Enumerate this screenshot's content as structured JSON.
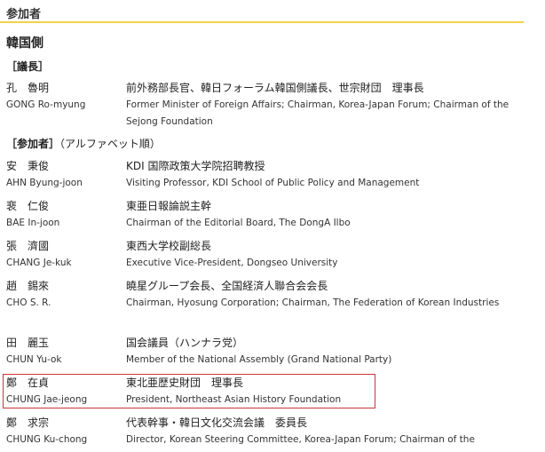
{
  "header": {
    "title": "参加者"
  },
  "side_title": "韓国側",
  "chair_section": {
    "label": "［議長］"
  },
  "participants_section": {
    "label": "［参加者］",
    "note": "（アルファベット順）"
  },
  "chair": [
    {
      "name_jp": "孔　魯明",
      "name_en": "GONG Ro-myung",
      "title_jp": "前外務部長官、韓日フォーラム韓国側議長、世宗財団　理事長",
      "title_en": "Former Minister of Foreign Affairs; Chairman, Korea-Japan Forum; Chairman of the Sejong Foundation"
    }
  ],
  "participants": [
    {
      "name_jp": "安　秉俊",
      "name_en": "AHN Byung-joon",
      "title_jp": "KDI 国際政策大学院招聘教授",
      "title_en": "Visiting Professor, KDI School of Public Policy and Management"
    },
    {
      "name_jp": "裵　仁俊",
      "name_en": "BAE In-joon",
      "title_jp": "東亜日報論説主幹",
      "title_en": "Chairman of the Editorial Board, The DongA Ilbo"
    },
    {
      "name_jp": "張　濟國",
      "name_en": "CHANG Je-kuk",
      "title_jp": "東西大学校副総長",
      "title_en": "Executive Vice-President, Dongseo University"
    },
    {
      "name_jp": "趙　錫來",
      "name_en": "CHO S. R.",
      "title_jp": "曉星グループ会長、全国経済人聯合会会長",
      "title_en": "Chairman, Hyosung Corporation; Chairman, The Federation of Korean Industries"
    },
    {
      "name_jp": "田　麗玉",
      "name_en": "CHUN Yu-ok",
      "title_jp": "国会議員（ハンナラ党）",
      "title_en": "Member of the National Assembly (Grand National Party)"
    },
    {
      "name_jp": "鄭　在貞",
      "name_en": "CHUNG Jae-jeong",
      "title_jp": "東北亜歴史財団　理事長",
      "title_en": "President, Northeast Asian History Foundation"
    },
    {
      "name_jp": "鄭　求宗",
      "name_en": "CHUNG Ku-chong",
      "title_jp": "代表幹事・韓日文化交流会議　委員長",
      "title_en": "Director, Korean Steering Committee, Korea-Japan Forum; Chairman of the"
    }
  ]
}
